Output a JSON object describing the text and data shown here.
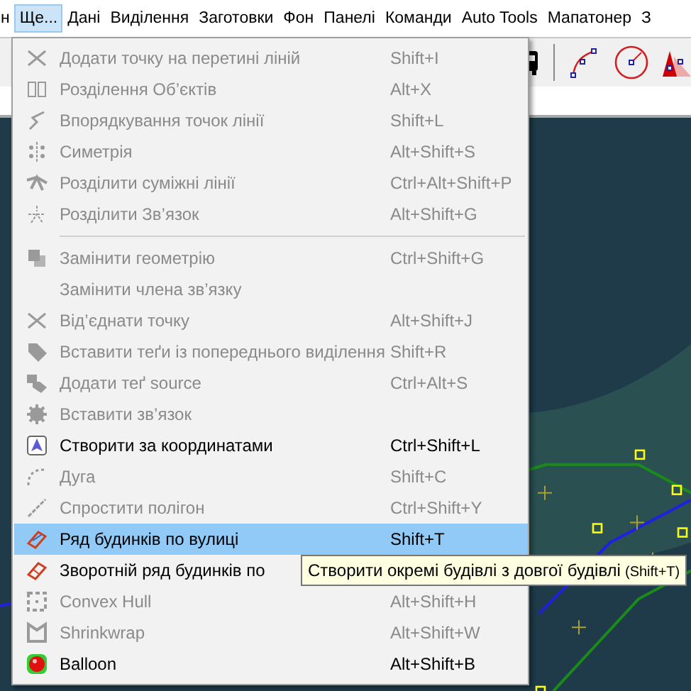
{
  "menubar": {
    "items": [
      {
        "label": "н",
        "selected": false
      },
      {
        "label": "Ще...",
        "selected": true
      },
      {
        "label": "Дані",
        "selected": false
      },
      {
        "label": "Виділення",
        "selected": false
      },
      {
        "label": "Заготовки",
        "selected": false
      },
      {
        "label": "Фон",
        "selected": false
      },
      {
        "label": "Панелі",
        "selected": false
      },
      {
        "label": "Команди",
        "selected": false
      },
      {
        "label": "Auto Tools",
        "selected": false
      },
      {
        "label": "Мапатонер",
        "selected": false
      },
      {
        "label": "З",
        "selected": false
      }
    ]
  },
  "menu": {
    "items": [
      {
        "kind": "item",
        "label": "Додати точку на перетині ліній",
        "shortcut": "Shift+I",
        "disabled": true,
        "selected": false
      },
      {
        "kind": "item",
        "label": "Розділення Об’єктів",
        "shortcut": "Alt+X",
        "disabled": true,
        "selected": false
      },
      {
        "kind": "item",
        "label": "Впорядкування точок лінії",
        "shortcut": "Shift+L",
        "disabled": true,
        "selected": false
      },
      {
        "kind": "item",
        "label": "Симетрія",
        "shortcut": "Alt+Shift+S",
        "disabled": true,
        "selected": false
      },
      {
        "kind": "item",
        "label": "Розділити суміжні лінії",
        "shortcut": "Ctrl+Alt+Shift+P",
        "disabled": true,
        "selected": false
      },
      {
        "kind": "item",
        "label": "Розділити Зв’язок",
        "shortcut": "Alt+Shift+G",
        "disabled": true,
        "selected": false
      },
      {
        "kind": "separator"
      },
      {
        "kind": "item",
        "label": "Замінити геометрію",
        "shortcut": "Ctrl+Shift+G",
        "disabled": true,
        "selected": false
      },
      {
        "kind": "item",
        "label": "Замінити члена зв’язку",
        "disabled": true,
        "selected": false
      },
      {
        "kind": "item",
        "label": "Від’єднати точку",
        "shortcut": "Alt+Shift+J",
        "disabled": true,
        "selected": false
      },
      {
        "kind": "item",
        "label": "Вставити теґи із попереднього виділення",
        "shortcut": "Shift+R",
        "disabled": true,
        "selected": false
      },
      {
        "kind": "item",
        "label": "Додати теґ source",
        "shortcut": "Ctrl+Alt+S",
        "disabled": true,
        "selected": false
      },
      {
        "kind": "item",
        "label": "Вставити зв’язок",
        "disabled": true,
        "selected": false
      },
      {
        "kind": "item",
        "label": "Створити за координатами",
        "shortcut": "Ctrl+Shift+L",
        "disabled": false,
        "selected": false
      },
      {
        "kind": "item",
        "label": "Дуга",
        "shortcut": "Shift+C",
        "disabled": true,
        "selected": false
      },
      {
        "kind": "item",
        "label": "Спростити полігон",
        "shortcut": "Ctrl+Shift+Y",
        "disabled": true,
        "selected": false
      },
      {
        "kind": "item",
        "label": "Ряд будинків по вулиці",
        "shortcut": "Shift+T",
        "disabled": false,
        "selected": true
      },
      {
        "kind": "item",
        "label": "Зворотній ряд будинків по",
        "disabled": false,
        "selected": false
      },
      {
        "kind": "item",
        "label": "Convex Hull",
        "shortcut": "Alt+Shift+H",
        "disabled": true,
        "selected": false
      },
      {
        "kind": "item",
        "label": "Shrinkwrap",
        "shortcut": "Alt+Shift+W",
        "disabled": true,
        "selected": false
      },
      {
        "kind": "item",
        "label": "Balloon",
        "shortcut": "Alt+Shift+B",
        "disabled": false,
        "selected": false
      }
    ]
  },
  "tooltip": {
    "text": "Створити окремі будівлі з довгої будівлі",
    "shortcut": "(Shift+T)"
  }
}
